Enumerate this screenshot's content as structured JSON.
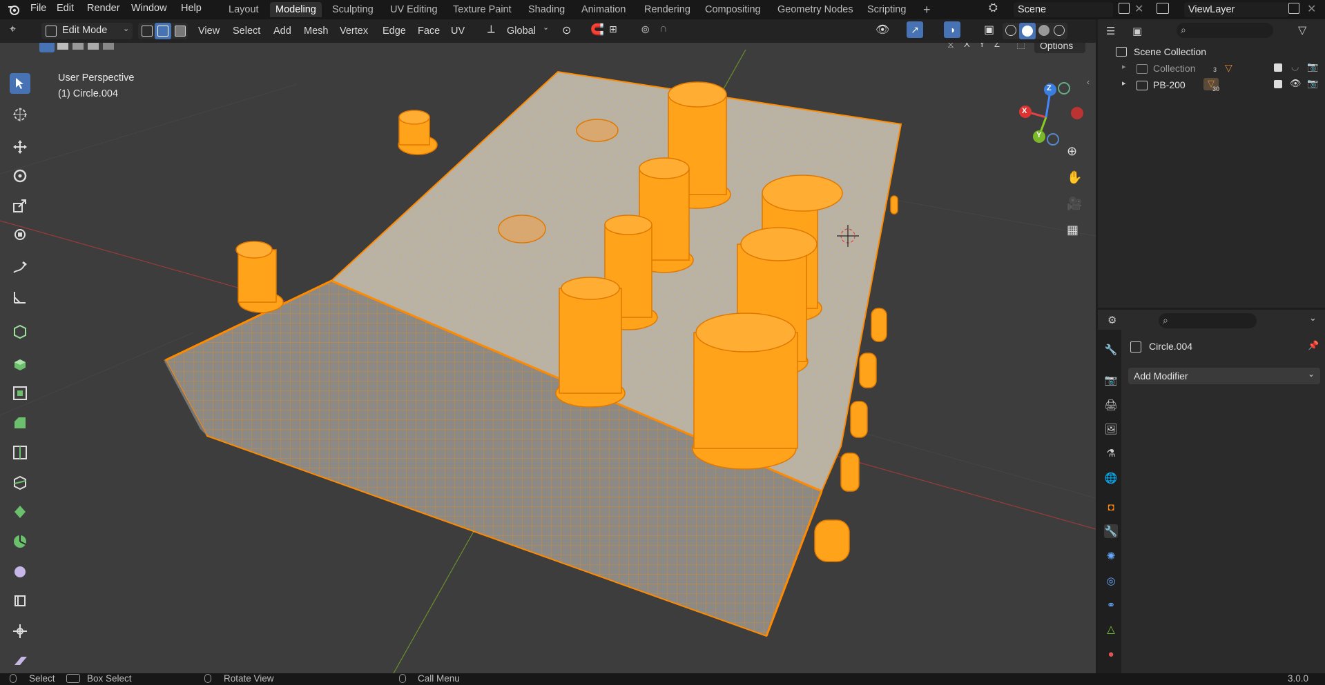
{
  "menu": {
    "items": [
      "File",
      "Edit",
      "Render",
      "Window",
      "Help"
    ]
  },
  "workspaces": [
    "Layout",
    "Modeling",
    "Sculpting",
    "UV Editing",
    "Texture Paint",
    "Shading",
    "Animation",
    "Rendering",
    "Compositing",
    "Geometry Nodes",
    "Scripting"
  ],
  "active_workspace": "Modeling",
  "scene": {
    "name": "Scene"
  },
  "view_layer": {
    "name": "ViewLayer"
  },
  "header": {
    "mode": "Edit Mode",
    "menus": [
      "View",
      "Select",
      "Add",
      "Mesh",
      "Vertex",
      "Edge",
      "Face",
      "UV"
    ],
    "orientation": "Global",
    "axes": [
      "X",
      "Y",
      "Z"
    ],
    "options": "Options"
  },
  "viewport": {
    "perspective": "User Perspective",
    "object_info": "(1) Circle.004",
    "gizmo": {
      "x": "X",
      "y": "Y",
      "z": "Z"
    },
    "mesh_color": "#ff9a00"
  },
  "outliner": {
    "root": "Scene Collection",
    "items": [
      {
        "name": "Collection",
        "badge": "3"
      },
      {
        "name": "PB-200",
        "badge": "30"
      }
    ]
  },
  "properties": {
    "object": "Circle.004",
    "add_modifier": "Add Modifier"
  },
  "status": {
    "select": "Select",
    "box_select": "Box Select",
    "rotate": "Rotate View",
    "call_menu": "Call Menu",
    "version": "3.0.0"
  }
}
